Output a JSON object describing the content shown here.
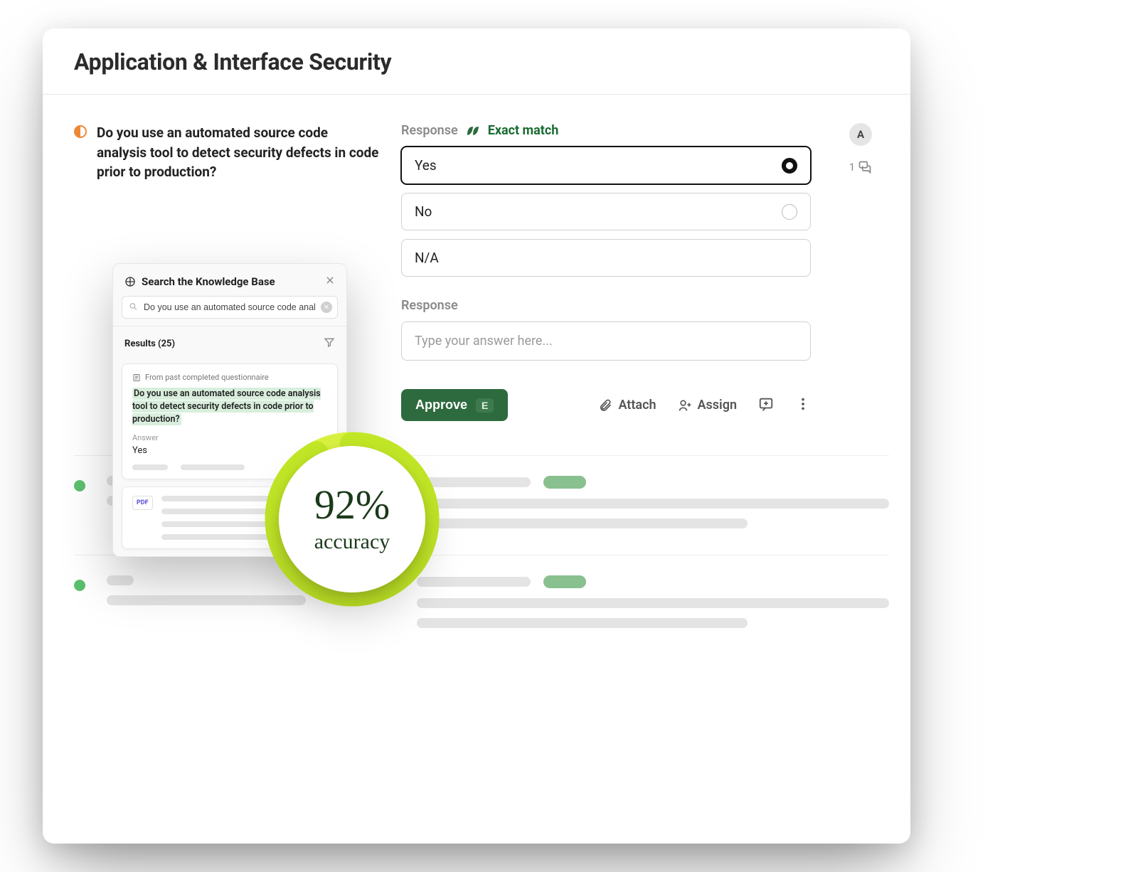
{
  "header": {
    "title": "Application & Interface Security"
  },
  "question": {
    "text": "Do you use an automated source code analysis tool to detect security defects in code prior to production?"
  },
  "response": {
    "label": "Response",
    "match_text": "Exact match",
    "options": [
      "Yes",
      "No",
      "N/A"
    ],
    "selected_index": 0,
    "free_label": "Response",
    "free_placeholder": "Type your answer here..."
  },
  "actions": {
    "approve": "Approve",
    "approve_kbd": "E",
    "attach": "Attach",
    "assign": "Assign"
  },
  "side": {
    "avatar_initial": "A",
    "comment_count": "1"
  },
  "kb": {
    "title": "Search the Knowledge Base",
    "search_value": "Do you use an automated source code analy...",
    "results_label": "Results (25)",
    "card1_meta": "From past completed questionnaire",
    "card1_question": "Do you use an automated source code analysis tool to detect security defects in code prior to production?",
    "card1_answer_label": "Answer",
    "card1_answer": "Yes",
    "pdf_label": "PDF"
  },
  "accuracy": {
    "percent": "92%",
    "label": "accuracy",
    "value": 92
  }
}
